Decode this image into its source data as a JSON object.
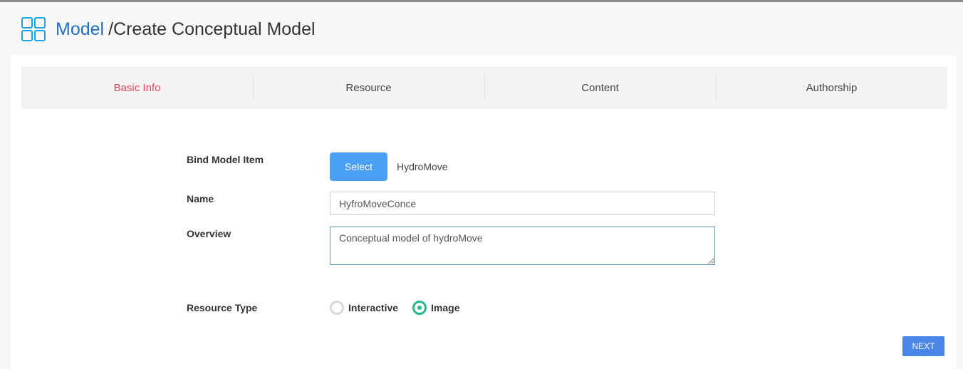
{
  "header": {
    "root": "Model",
    "page": "/Create Conceptual Model"
  },
  "tabs": [
    {
      "label": "Basic Info",
      "active": true
    },
    {
      "label": "Resource",
      "active": false
    },
    {
      "label": "Content",
      "active": false
    },
    {
      "label": "Authorship",
      "active": false
    }
  ],
  "form": {
    "bind_label": "Bind Model Item",
    "select_button": "Select",
    "bound_item": "HydroMove",
    "name_label": "Name",
    "name_value": "HyfroMoveConce",
    "overview_label": "Overview",
    "overview_value": "Conceptual model of hydroMove",
    "resource_type_label": "Resource Type",
    "resource_types": [
      {
        "label": "Interactive",
        "checked": false
      },
      {
        "label": "Image",
        "checked": true
      }
    ]
  },
  "next_button": "NEXT",
  "colors": {
    "brand": "#1f6fc4",
    "active_tab": "#e0475a",
    "primary_button": "#4aa0f5",
    "radio_checked": "#21b78f"
  }
}
